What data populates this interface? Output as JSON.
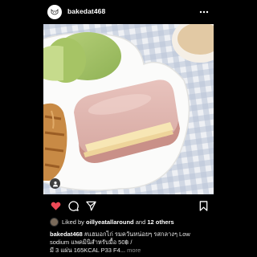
{
  "post": {
    "username": "bakedat468",
    "avatar_icon": "fox-logo-icon",
    "more_icon": "more-dots-icon"
  },
  "photo": {
    "description_icon": "food-photo-image",
    "tag_icon": "person-tag-icon"
  },
  "actions": {
    "like_icon": "heart-filled-icon",
    "comment_icon": "comment-icon",
    "share_icon": "share-plane-icon",
    "save_icon": "bookmark-icon",
    "like_color": "#ed4956"
  },
  "likes": {
    "prefix": "Liked by",
    "user": "oillyeatallaround",
    "connector": "and",
    "others": "12 others"
  },
  "caption": {
    "username": "bakedat468",
    "line1": "#แฮมอกไก่ รมควันหน่อยๆ รสกลางๆ Low",
    "line2": "sodium แพคมินิสำหรับมื้อ 50฿ /",
    "line3": "มี 3 แผ่น 165KCAL P33 F4...",
    "more": "more"
  }
}
